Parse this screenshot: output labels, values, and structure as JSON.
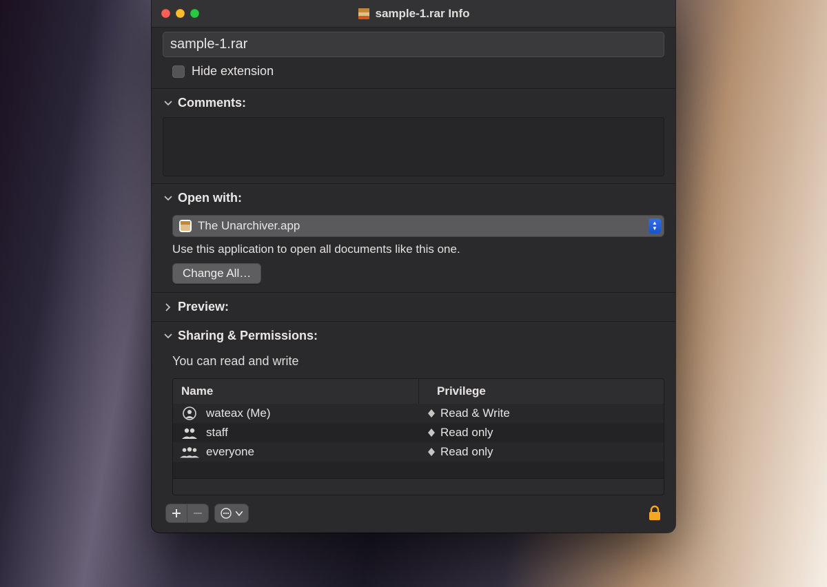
{
  "window": {
    "title": "sample-1.rar Info"
  },
  "filename": "sample-1.rar",
  "hide_extension_label": "Hide extension",
  "sections": {
    "comments": "Comments:",
    "open_with": "Open with:",
    "preview": "Preview:",
    "sharing": "Sharing & Permissions:"
  },
  "open_with": {
    "selected": "The Unarchiver.app",
    "helper": "Use this application to open all documents like this one.",
    "change_all_label": "Change All…"
  },
  "permissions": {
    "summary": "You can read and write",
    "columns": {
      "name": "Name",
      "privilege": "Privilege"
    },
    "rows": [
      {
        "icon": "user",
        "name": "wateax (Me)",
        "privilege": "Read & Write"
      },
      {
        "icon": "group",
        "name": "staff",
        "privilege": "Read only"
      },
      {
        "icon": "group3",
        "name": "everyone",
        "privilege": "Read only"
      }
    ]
  }
}
